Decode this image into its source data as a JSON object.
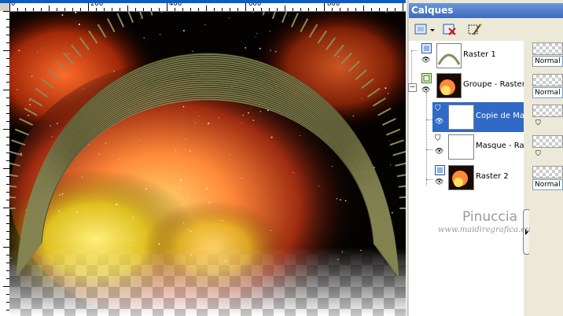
{
  "ruler": {
    "ticks": [
      "0",
      "200",
      "400",
      "600",
      "800"
    ]
  },
  "palette": {
    "title": "Calques",
    "layers": [
      {
        "name": "Raster 1",
        "selected": false
      },
      {
        "name": "Groupe - Raster 2",
        "selected": false
      },
      {
        "name": "Copie de Masque - Raster 2",
        "selected": true
      },
      {
        "name": "Masque - Raster 2",
        "selected": false
      },
      {
        "name": "Raster 2",
        "selected": false
      }
    ],
    "collapse_glyph": "⊟"
  },
  "props": {
    "rows": [
      {
        "blend": "Normal"
      },
      {
        "blend": "Normal"
      },
      {
        "blend": ""
      },
      {
        "blend": ""
      },
      {
        "blend": "Normal"
      }
    ]
  },
  "watermark": {
    "name": "Pinuccia",
    "url": "www.maidiregrafica.eu"
  },
  "colors": {
    "title_bar": "#3d6bc0",
    "selection": "#316ac5",
    "arch": "#8a8a55"
  }
}
